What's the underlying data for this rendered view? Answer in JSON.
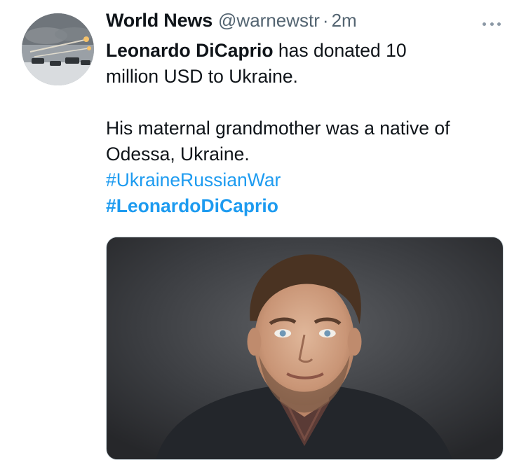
{
  "tweet": {
    "author": {
      "display_name": "World News",
      "handle": "@warnewstr",
      "separator": "·",
      "time": "2m",
      "avatar_icon": "avatar-image"
    },
    "body": {
      "line1_bold": "Leonardo DiCaprio",
      "line1_rest": " has donated 10",
      "line2": "million USD to Ukraine.",
      "line3": "His maternal grandmother was a native of",
      "line4": "Odessa, Ukraine."
    },
    "hashtags": [
      {
        "text": "#UkraineRussianWar",
        "bold": false
      },
      {
        "text": "#LeonardoDiCaprio",
        "bold": true
      }
    ],
    "more_icon": "more-options-icon",
    "media_icon": "portrait-photo",
    "colors": {
      "link": "#1d9bf0",
      "text": "#0f1419",
      "muted": "#536471"
    }
  }
}
